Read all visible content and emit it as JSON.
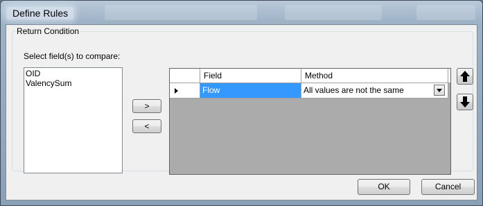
{
  "window": {
    "title": "Define Rules"
  },
  "group": {
    "legend": "Return Condition"
  },
  "fields": {
    "label": "Select field(s) to compare:",
    "items": [
      "OID",
      "ValencySum"
    ]
  },
  "move_buttons": {
    "add": ">",
    "remove": "<"
  },
  "grid": {
    "columns": [
      "Field",
      "Method"
    ],
    "rows": [
      {
        "field": "Flow",
        "method": "All values are not the same"
      }
    ]
  },
  "order_buttons": {
    "up_icon": "arrow-up-icon",
    "down_icon": "arrow-down-icon"
  },
  "dialog_buttons": {
    "ok": "OK",
    "cancel": "Cancel"
  },
  "colors": {
    "selected_cell": "#3399ff",
    "grid_background": "#ababab"
  }
}
